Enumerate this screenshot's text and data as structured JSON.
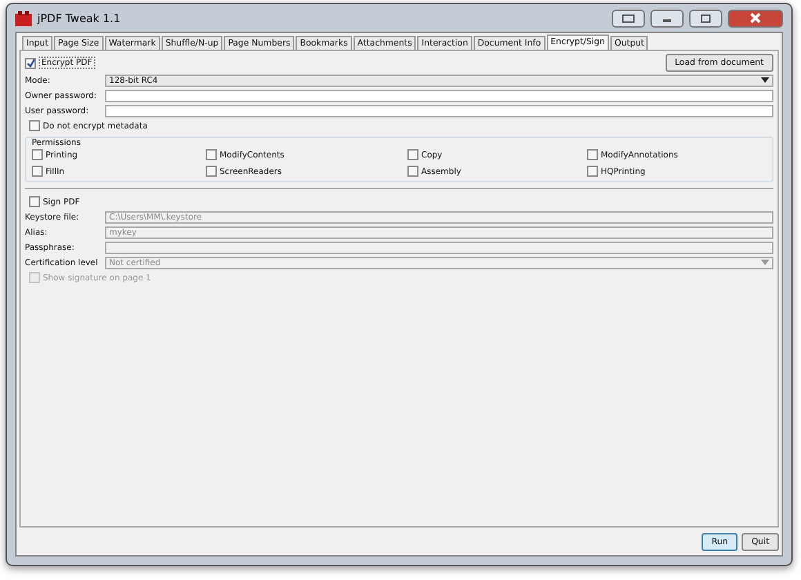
{
  "window": {
    "title": "jPDF Tweak 1.1"
  },
  "tabs": [
    {
      "label": "Input",
      "selected": false
    },
    {
      "label": "Page Size",
      "selected": false
    },
    {
      "label": "Watermark",
      "selected": false
    },
    {
      "label": "Shuffle/N-up",
      "selected": false
    },
    {
      "label": "Page Numbers",
      "selected": false
    },
    {
      "label": "Bookmarks",
      "selected": false
    },
    {
      "label": "Attachments",
      "selected": false
    },
    {
      "label": "Interaction",
      "selected": false
    },
    {
      "label": "Document Info",
      "selected": false
    },
    {
      "label": "Encrypt/Sign",
      "selected": true
    },
    {
      "label": "Output",
      "selected": false
    }
  ],
  "encrypt": {
    "label": "Encrypt PDF",
    "checked": true,
    "load_button": "Load from document",
    "fields": [
      {
        "kind": "select",
        "label": "Mode:",
        "value": "128-bit RC4"
      },
      {
        "kind": "input",
        "label": "Owner password:"
      },
      {
        "kind": "input",
        "label": "User password:"
      }
    ],
    "metadata": {
      "label": "Do not encrypt metadata",
      "checked": false
    },
    "permissions": {
      "title": "Permissions",
      "items": [
        {
          "label": "Printing",
          "checked": false
        },
        {
          "label": "ModifyContents",
          "checked": false
        },
        {
          "label": "Copy",
          "checked": false
        },
        {
          "label": "ModifyAnnotations",
          "checked": false
        },
        {
          "label": "FillIn",
          "checked": false
        },
        {
          "label": "ScreenReaders",
          "checked": false
        },
        {
          "label": "Assembly",
          "checked": false
        },
        {
          "label": "HQPrinting",
          "checked": false
        }
      ]
    }
  },
  "sign": {
    "label": "Sign PDF",
    "checked": false,
    "fields": [
      {
        "kind": "input",
        "label": "Keystore file:",
        "value": "C:\\Users\\MM\\.keystore",
        "disabled": true
      },
      {
        "kind": "input",
        "label": "Alias:",
        "value": "mykey",
        "disabled": true
      },
      {
        "kind": "input",
        "label": "Passphrase:",
        "disabled": true
      },
      {
        "kind": "select",
        "label": "Certification level",
        "value": "Not certified",
        "disabled": true
      }
    ],
    "show": {
      "label": "Show signature on page 1",
      "checked": false,
      "disabled": true
    }
  },
  "buttons": [
    "Run",
    "Quit"
  ]
}
